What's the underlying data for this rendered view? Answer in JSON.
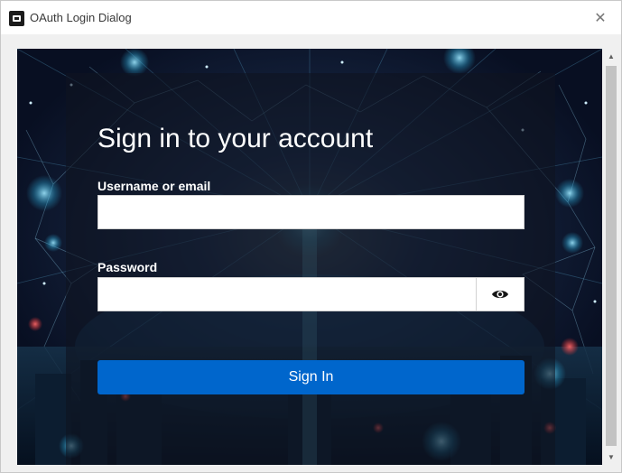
{
  "window": {
    "title": "OAuth Login Dialog",
    "close_glyph": "✕",
    "icon": "app-icon"
  },
  "login": {
    "heading": "Sign in to your account",
    "username_label": "Username or email",
    "username_value": "",
    "password_label": "Password",
    "password_value": "",
    "show_password_icon": "eye-icon",
    "submit_label": "Sign In"
  },
  "scrollbar": {
    "up_glyph": "▲",
    "down_glyph": "▼"
  },
  "colors": {
    "primary_button": "#0066cc",
    "background": "#0a1226"
  }
}
